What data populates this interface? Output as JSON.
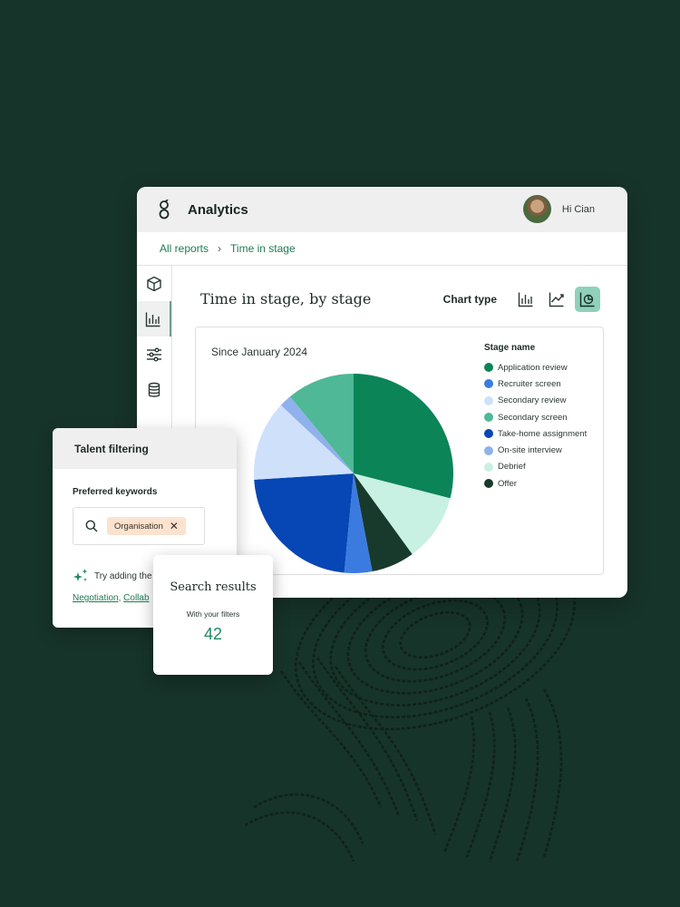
{
  "header": {
    "app_title": "Analytics",
    "greeting": "Hi Cian"
  },
  "breadcrumb": {
    "root": "All reports",
    "separator": "›",
    "current": "Time in stage"
  },
  "sidebar": {
    "items": [
      {
        "icon": "cube-icon",
        "active": false
      },
      {
        "icon": "bar-chart-icon",
        "active": true
      },
      {
        "icon": "sliders-icon",
        "active": false
      },
      {
        "icon": "database-icon",
        "active": false
      }
    ]
  },
  "main": {
    "title": "Time in stage, by stage",
    "chart_type_label": "Chart type",
    "chart_type_options": [
      "bar-chart-icon",
      "line-chart-icon",
      "pie-chart-icon"
    ],
    "chart_type_selected": "pie-chart-icon",
    "subtitle": "Since January 2024"
  },
  "chart_data": {
    "type": "pie",
    "title": "Time in stage, by stage",
    "subtitle": "Since January 2024",
    "legend_title": "Stage name",
    "legend_position": "right",
    "categories": [
      "Application review",
      "Recruiter screen",
      "Secondary review",
      "Secondary screen",
      "Take-home assignment",
      "On-site interview",
      "Debrief",
      "Offer"
    ],
    "colors": [
      "#0b8458",
      "#3b7be0",
      "#cfe0fb",
      "#4fb896",
      "#0746b5",
      "#8fb1ec",
      "#c8f0e3",
      "#183a2c"
    ],
    "slices": [
      {
        "label": "Application review",
        "value": 29.0,
        "color": "#0b8458"
      },
      {
        "label": "Debrief",
        "value": 11.0,
        "color": "#c8f0e3"
      },
      {
        "label": "Offer",
        "value": 7.0,
        "color": "#183a2c"
      },
      {
        "label": "Recruiter screen",
        "value": 4.5,
        "color": "#3b7be0"
      },
      {
        "label": "Take-home assignment",
        "value": 22.5,
        "color": "#0746b5"
      },
      {
        "label": "Secondary review",
        "value": 13.0,
        "color": "#cfe0fb"
      },
      {
        "label": "On-site interview",
        "value": 2.0,
        "color": "#8fb1ec"
      },
      {
        "label": "Secondary screen",
        "value": 11.0,
        "color": "#4fb896"
      }
    ]
  },
  "talent": {
    "title": "Talent filtering",
    "keywords_label": "Preferred keywords",
    "chip": "Organisation",
    "chip_remove": "✕",
    "hint": "Try adding the",
    "links": [
      "Negotiation",
      "Collab"
    ],
    "link_separator": ", "
  },
  "search": {
    "title": "Search results",
    "subtitle": "With your filters",
    "count": "42"
  }
}
